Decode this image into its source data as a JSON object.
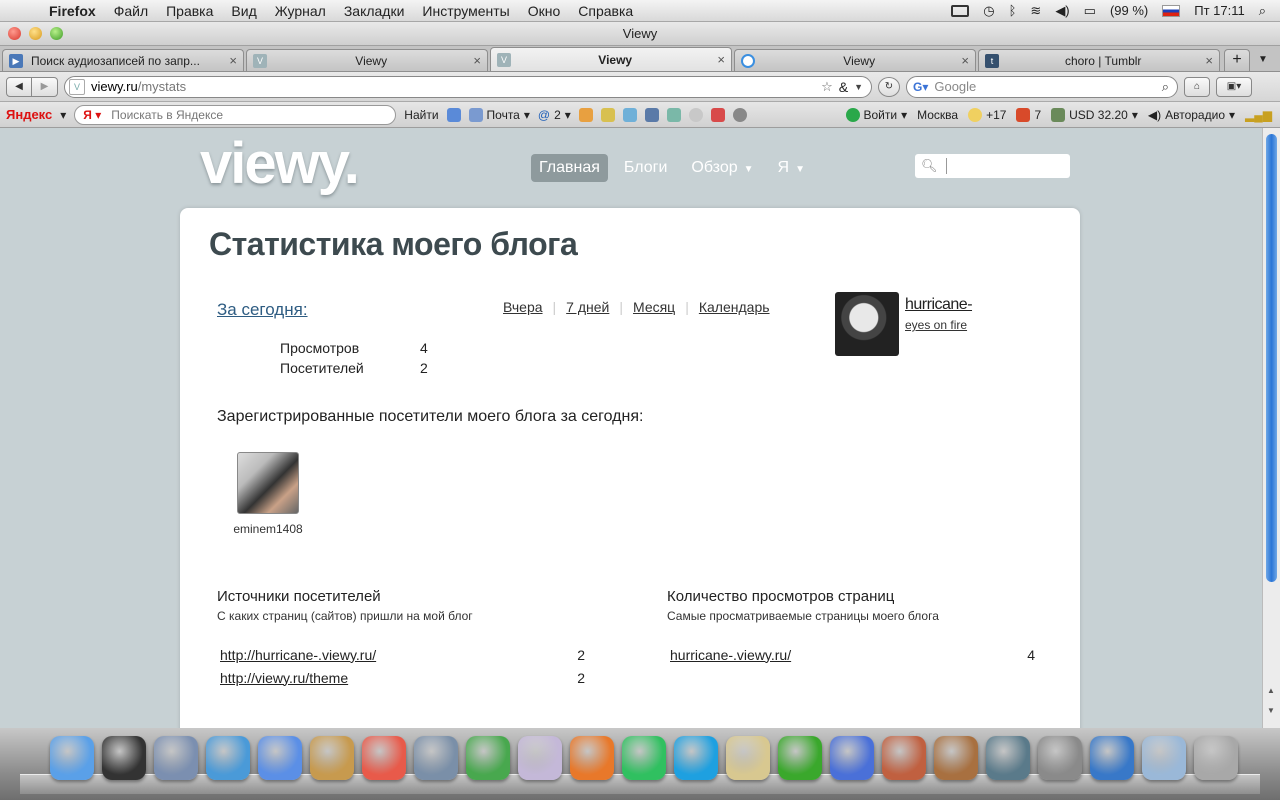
{
  "menubar": {
    "app": "Firefox",
    "items": [
      "Файл",
      "Правка",
      "Вид",
      "Журнал",
      "Закладки",
      "Инструменты",
      "Окно",
      "Справка"
    ],
    "battery": "(99 %)",
    "clock": "Пт 17:11"
  },
  "window": {
    "title": "Viewy"
  },
  "tabs": [
    {
      "title": "Поиск аудиозаписей по запр...",
      "favicon_color": "#4a78b8",
      "favicon_glyph": "▶"
    },
    {
      "title": "Viewy",
      "favicon_color": "#9fb3b8",
      "favicon_glyph": "V"
    },
    {
      "title": "Viewy",
      "favicon_color": "#9fb3b8",
      "favicon_glyph": "V",
      "active": true
    },
    {
      "title": "Viewy",
      "favicon_color": "#3b8fe0",
      "favicon_glyph": "◌"
    },
    {
      "title": "choro | Tumblr",
      "favicon_color": "#35506e",
      "favicon_glyph": "t"
    }
  ],
  "nav": {
    "url_host": "viewy.ru",
    "url_path": "/mystats",
    "search_engine": "Google",
    "search_placeholder": "Google"
  },
  "yandex": {
    "logo": "Яндекс",
    "placeholder": "Поискать в Яндексе",
    "find_button": "Найти",
    "mail": "Почта",
    "mail_count": "2",
    "login": "Войти",
    "city": "Москва",
    "temp": "+17",
    "traffic": "7",
    "usd": "USD 32.20",
    "radio": "Авторадио"
  },
  "site": {
    "logo": "viewy.",
    "nav": [
      {
        "label": "Главная",
        "selected": true,
        "dropdown": false
      },
      {
        "label": "Блоги",
        "selected": false,
        "dropdown": false
      },
      {
        "label": "Обзор",
        "selected": false,
        "dropdown": true
      },
      {
        "label": "Я",
        "selected": false,
        "dropdown": true
      }
    ]
  },
  "stats": {
    "heading": "Статистика моего блога",
    "today_label": "За сегодня:",
    "periods": [
      "Вчера",
      "7 дней",
      "Месяц",
      "Календарь"
    ],
    "rows": [
      {
        "label": "Просмотров",
        "value": "4"
      },
      {
        "label": "Посетителей",
        "value": "2"
      }
    ],
    "profile": {
      "name": "hurricane-",
      "tagline": "eyes on fire"
    },
    "registered_heading": "Зарегистрированные посетители моего блога за сегодня:",
    "visitors": [
      {
        "name": "eminem1408"
      }
    ],
    "sources": {
      "title": "Источники посетителей",
      "subtitle": "С каких страниц (сайтов) пришли на мой блог",
      "rows": [
        {
          "url": "http://hurricane-.viewy.ru/",
          "count": "2"
        },
        {
          "url": "http://viewy.ru/theme",
          "count": "2"
        }
      ]
    },
    "pageviews": {
      "title": "Количество просмотров страниц",
      "subtitle": "Самые просматриваемые страницы моего блога",
      "rows": [
        {
          "url": "hurricane-.viewy.ru/",
          "count": "4"
        }
      ]
    }
  },
  "dock": [
    {
      "name": "finder-icon",
      "color": "#5aa0e8"
    },
    {
      "name": "dashboard-icon",
      "color": "#333"
    },
    {
      "name": "mail-bird-icon",
      "color": "#7b8fb0"
    },
    {
      "name": "safari-icon",
      "color": "#4a9ad8"
    },
    {
      "name": "ichat-icon",
      "color": "#5b8fe6"
    },
    {
      "name": "address-book-icon",
      "color": "#c79a4e"
    },
    {
      "name": "calendar-icon",
      "color": "#e85a4a"
    },
    {
      "name": "iphoto-icon",
      "color": "#7a8fa8"
    },
    {
      "name": "adium-icon",
      "color": "#48a84e"
    },
    {
      "name": "preview-icon",
      "color": "#c4b8d8"
    },
    {
      "name": "firefox-icon",
      "color": "#e8782a"
    },
    {
      "name": "mail-at-icon",
      "color": "#30c060"
    },
    {
      "name": "skype-icon",
      "color": "#1ea0e0"
    },
    {
      "name": "dvd-icon",
      "color": "#d8c890"
    },
    {
      "name": "icq-icon",
      "color": "#3aa82c"
    },
    {
      "name": "itunes-icon",
      "color": "#4a70d8"
    },
    {
      "name": "photo-booth-icon",
      "color": "#c06040"
    },
    {
      "name": "garageband-icon",
      "color": "#a87040"
    },
    {
      "name": "time-machine-icon",
      "color": "#5a7a8a"
    },
    {
      "name": "system-preferences-icon",
      "color": "#8a8a8a"
    },
    {
      "name": "quicktime-icon",
      "color": "#3878c8"
    },
    {
      "name": "applications-folder-icon",
      "color": "#9ab8d8"
    },
    {
      "name": "trash-icon",
      "color": "#a8a8a8"
    }
  ]
}
